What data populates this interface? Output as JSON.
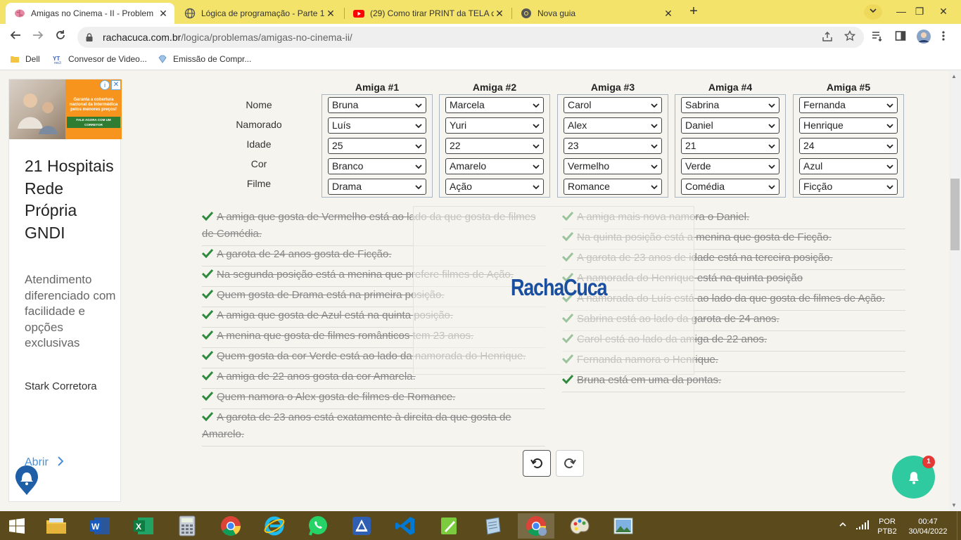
{
  "browser": {
    "tabs": [
      {
        "title": "Amigas no Cinema - II - Problem",
        "active": true
      },
      {
        "title": "Lógica de programação - Parte 1",
        "active": false
      },
      {
        "title": "(29) Como tirar PRINT da TELA d",
        "active": false
      },
      {
        "title": "Nova guia",
        "active": false
      }
    ],
    "url_host": "rachacuca.com.br",
    "url_path": "/logica/problemas/amigas-no-cinema-ii/",
    "bookmarks": [
      "Dell",
      "Convesor de Video...",
      "Emissão de Compr..."
    ]
  },
  "ad": {
    "title": "21 Hospitais Rede Própria GNDI",
    "description": "Atendimento diferenciado com facilidade e opções exclusivas",
    "company": "Stark Corretora",
    "open_label": "Abrir",
    "banner_text": "Garanta a cobertura nacional da Intermédica pelos menores preços!",
    "banner_cta": "FALE AGORA COM UM CORRETOR"
  },
  "puzzle": {
    "row_labels": [
      "Nome",
      "Namorado",
      "Idade",
      "Cor",
      "Filme"
    ],
    "columns": [
      {
        "header": "Amiga #1",
        "values": [
          "Bruna",
          "Luís",
          "25",
          "Branco",
          "Drama"
        ]
      },
      {
        "header": "Amiga #2",
        "values": [
          "Marcela",
          "Yuri",
          "22",
          "Amarelo",
          "Ação"
        ]
      },
      {
        "header": "Amiga #3",
        "values": [
          "Carol",
          "Alex",
          "23",
          "Vermelho",
          "Romance"
        ]
      },
      {
        "header": "Amiga #4",
        "values": [
          "Sabrina",
          "Daniel",
          "21",
          "Verde",
          "Comédia"
        ]
      },
      {
        "header": "Amiga #5",
        "values": [
          "Fernanda",
          "Henrique",
          "24",
          "Azul",
          "Ficção"
        ]
      }
    ],
    "clues_left": [
      "A amiga que gosta de Vermelho está ao lado da que gosta de filmes de Comédia.",
      "A garota de 24 anos gosta de Ficção.",
      "Na segunda posição está a menina que prefere filmes de Ação.",
      "Quem gosta de Drama está na primeira posição.",
      "A amiga que gosta de Azul está na quinta posição.",
      "A menina que gosta de filmes românticos tem 23 anos.",
      "Quem gosta da cor Verde está ao lado da namorada do Henrique.",
      "A amiga de 22 anos gosta da cor Amarela.",
      "Quem namora o Alex gosta de filmes de Romance.",
      "A garota de 23 anos está exatamente à direita da que gosta de Amarelo."
    ],
    "clues_right": [
      "A amiga mais nova namora o Daniel.",
      "Na quinta posição está a menina que gosta de Ficção.",
      "A garota de 23 anos de idade está na terceira posição.",
      "A namorada do Henrique está na quinta posição",
      "A namorada do Luís está ao lado da que gosta de filmes de Ação.",
      "Sabrina está ao lado da garota de 24 anos.",
      "Carol está ao lado da amiga de 22 anos.",
      "Fernanda namora o Henrique.",
      "Bruna está em uma da pontas."
    ],
    "logo_part1": "Racha",
    "logo_part2": "Cuca"
  },
  "notification_count": "1",
  "taskbar": {
    "apps": [
      "file-explorer",
      "word",
      "excel",
      "calculator",
      "chrome",
      "internet-explorer",
      "whatsapp",
      "snipping-tool",
      "vscode",
      "notepad-plus",
      "notes",
      "chrome-active",
      "paint",
      "photos"
    ],
    "lang_top": "POR",
    "lang_bottom": "PTB2",
    "time": "00:47",
    "date": "30/04/2022"
  },
  "colors": {
    "tabbar": "#f3e36b",
    "page_bg": "#f5f4ee",
    "check_green": "#2e8b3d",
    "logo_blue": "#1a4fa0",
    "notif_teal": "#2fcaa0",
    "taskbar": "#5a4a1c"
  }
}
